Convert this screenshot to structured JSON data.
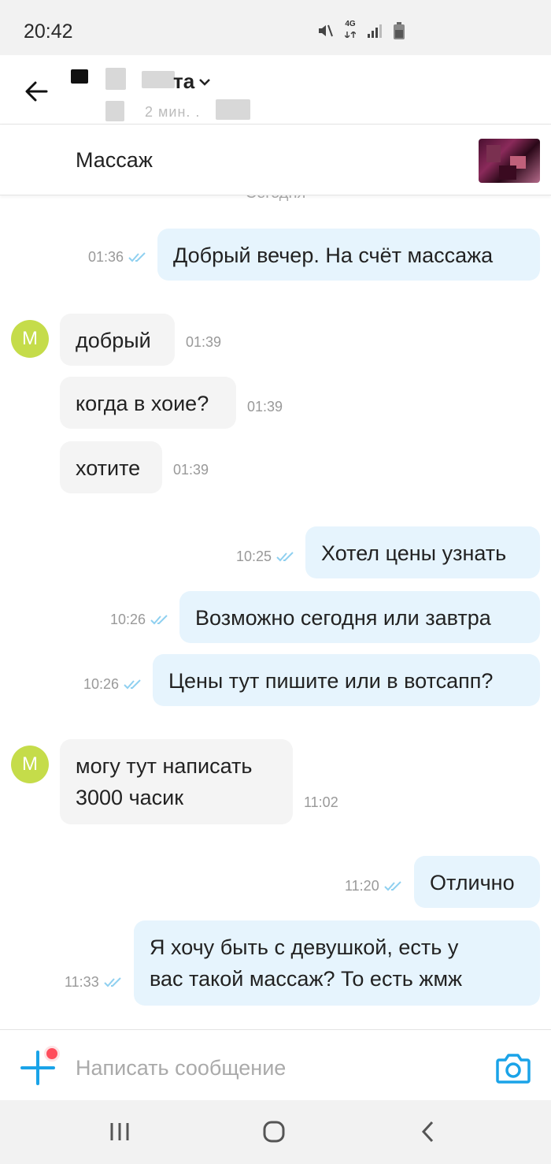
{
  "status_bar": {
    "time": "20:42",
    "network_label": "4G",
    "icons": [
      "mute-icon",
      "network-4g-icon",
      "signal-icon",
      "battery-icon"
    ]
  },
  "header": {
    "title_visible": "та",
    "subtitle_visible": "2 мин. ."
  },
  "ad": {
    "title": "Массаж"
  },
  "chat": {
    "date_separator": "Сегодня",
    "avatar_letter": "M",
    "messages": [
      {
        "dir": "out",
        "text": "Добрый вечер. На счёт массажа",
        "time": "01:36"
      },
      {
        "dir": "in",
        "text": "добрый",
        "time": "01:39"
      },
      {
        "dir": "in",
        "text": "когда в хоие?",
        "time": "01:39"
      },
      {
        "dir": "in",
        "text": "хотите",
        "time": "01:39"
      },
      {
        "dir": "out",
        "text": "Хотел цены узнать",
        "time": "10:25"
      },
      {
        "dir": "out",
        "text": "Возможно сегодня или завтра",
        "time": "10:26"
      },
      {
        "dir": "out",
        "text": "Цены тут пишите или в вотсапп?",
        "time": "10:26"
      },
      {
        "dir": "in",
        "text_line1": "могу тут написать",
        "text_line2": "3000 часик",
        "time": "11:02"
      },
      {
        "dir": "out",
        "text": "Отлично",
        "time": "11:20"
      },
      {
        "dir": "out",
        "text_line1": "Я хочу быть с девушкой, есть у",
        "text_line2": "вас такой массаж? То есть жмж",
        "time": "11:33"
      }
    ]
  },
  "input": {
    "placeholder": "Написать сообщение"
  },
  "colors": {
    "accent": "#1aa3e8",
    "outgoing_bubble": "#e6f4fd",
    "incoming_bubble": "#f4f4f4",
    "avatar": "#c5dc4a",
    "notification_dot": "#ff4d5c",
    "read_ticks": "#8fd0f0"
  }
}
